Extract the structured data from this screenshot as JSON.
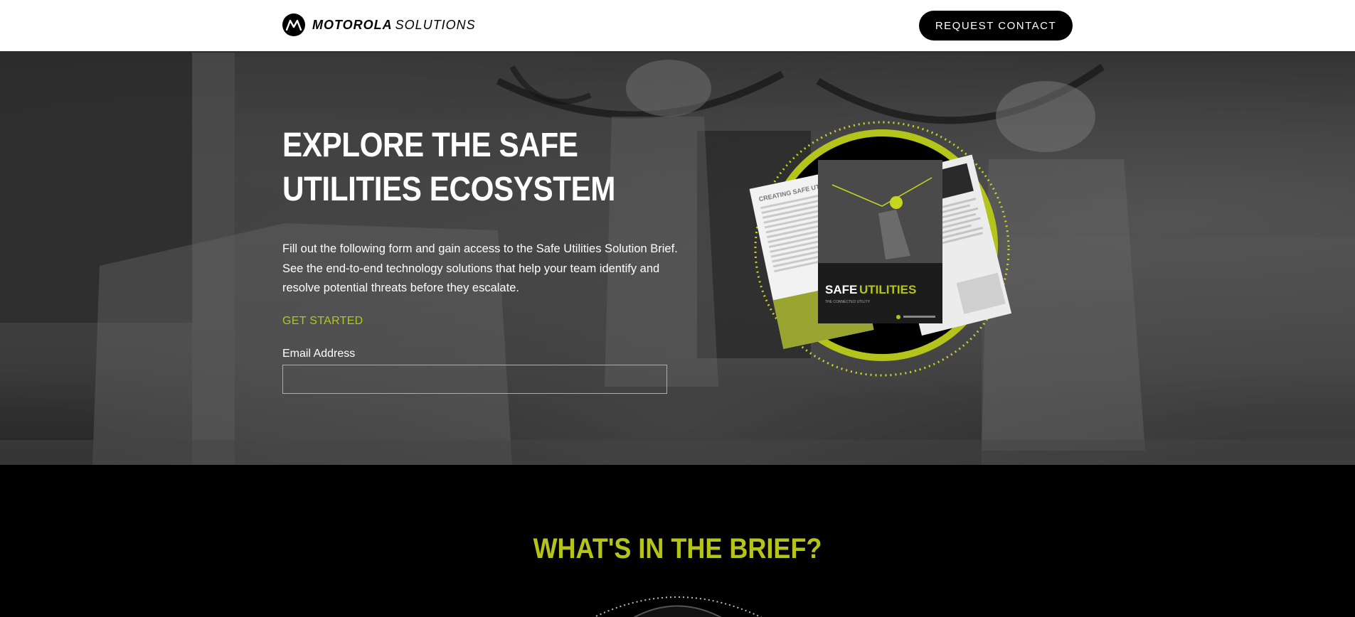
{
  "header": {
    "brand": "MOTOROLA",
    "brand_sub": "SOLUTIONS",
    "logo_icon": "motorola-m-icon",
    "request_label": "REQUEST CONTACT"
  },
  "hero": {
    "title_line1": "EXPLORE THE SAFE",
    "title_line2": "UTILITIES ECOSYSTEM",
    "description": "Fill out the following form and gain access to the Safe Utilities Solution Brief. See the end-to-end technology solutions that help your team identify and resolve potential threats before they escalate.",
    "cta": "GET STARTED",
    "email_label": "Email Address",
    "email_value": "",
    "brochure": {
      "cover_title_1": "SAFE",
      "cover_title_2": "UTILITIES",
      "cover_subtitle": "THE CONNECTED UTILITY",
      "left_page_title": "CREATING SAFE UTILITIES"
    }
  },
  "brief": {
    "title": "WHAT'S IN THE BRIEF?"
  },
  "colors": {
    "accent": "#b5c41b",
    "header_bg": "#ffffff",
    "button_bg": "#000000",
    "footer_bg": "#000000"
  }
}
